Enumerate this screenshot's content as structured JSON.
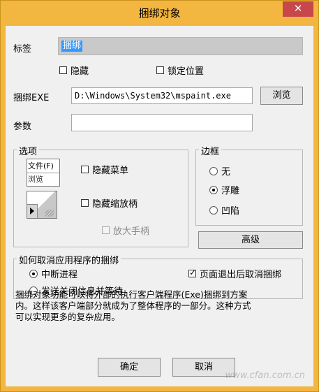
{
  "window": {
    "title": "捆绑对象",
    "close_glyph": "✕"
  },
  "tag": {
    "label": "标签",
    "value": "捆绑"
  },
  "top_checks": {
    "hide": {
      "label": "隐藏",
      "checked": false
    },
    "lock": {
      "label": "锁定位置",
      "checked": false
    }
  },
  "exe": {
    "label": "捆绑EXE",
    "value": "D:\\Windows\\System32\\mspaint.exe",
    "browse": "浏览"
  },
  "params": {
    "label": "参数",
    "value": ""
  },
  "options": {
    "title": "选项",
    "preview_menu": "文件(F)",
    "preview_sub": "浏览",
    "hide_menu": {
      "label": "隐藏菜单",
      "checked": false
    },
    "hide_resize": {
      "label": "隐藏缩放柄",
      "checked": false
    },
    "zoom_handle": {
      "label": "放大手柄",
      "checked": false,
      "disabled": true
    }
  },
  "border": {
    "title": "边框",
    "none": {
      "label": "无",
      "selected": false
    },
    "raised": {
      "label": "浮雕",
      "selected": true
    },
    "sunken": {
      "label": "凹陷",
      "selected": false
    }
  },
  "advanced": "高级",
  "unbind": {
    "title": "如何取消应用程序的捆绑",
    "interrupt": {
      "label": "中断进程",
      "selected": true
    },
    "send_close": {
      "label": "发送关闭信息并等待",
      "selected": false
    },
    "on_exit": {
      "label": "页面退出后取消捆绑",
      "checked": true
    }
  },
  "description": {
    "line1": "捆绑对象功能可以将外部的执行客户端程序(Exe)捆绑到方案",
    "line2": "内。这样该客户端部分就成为了整体程序的一部分。这种方式",
    "line3": "可以实现更多的复杂应用。"
  },
  "ok": "确定",
  "cancel": "取消",
  "watermark": "www.cfan.com.cn",
  "colors": {
    "frame": "#f3b640",
    "close": "#c7474a",
    "selection": "#3399ff",
    "client": "#f0f0f0"
  }
}
